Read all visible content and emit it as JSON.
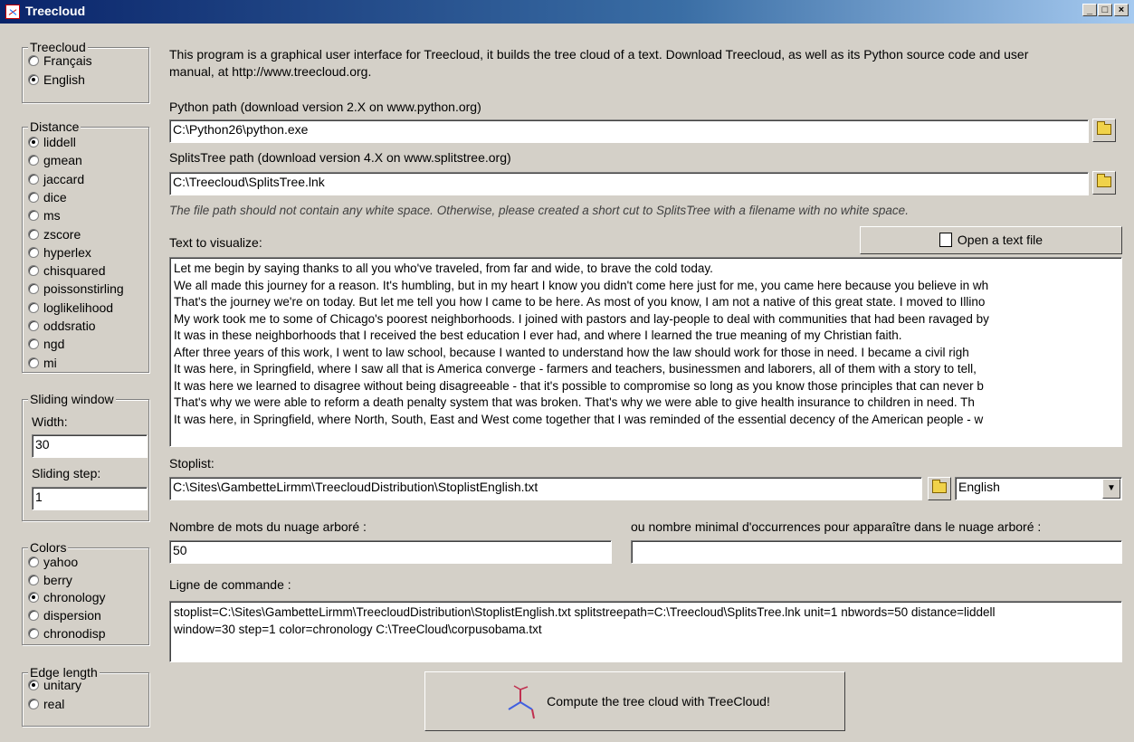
{
  "window": {
    "title": "Treecloud",
    "minimize": "_",
    "maximize": "□",
    "close": "×"
  },
  "left": {
    "language": {
      "legend": "Treecloud",
      "options": [
        "Français",
        "English"
      ],
      "selected": "English"
    },
    "distance": {
      "legend": "Distance",
      "options": [
        "liddell",
        "gmean",
        "jaccard",
        "dice",
        "ms",
        "zscore",
        "hyperlex",
        "chisquared",
        "poissonstirling",
        "loglikelihood",
        "oddsratio",
        "ngd",
        "mi"
      ],
      "selected": "liddell"
    },
    "sliding": {
      "legend": "Sliding window",
      "width_label": "Width:",
      "width_value": "30",
      "step_label": "Sliding step:",
      "step_value": "1"
    },
    "colors": {
      "legend": "Colors",
      "options": [
        "yahoo",
        "berry",
        "chronology",
        "dispersion",
        "chronodisp"
      ],
      "selected": "chronology"
    },
    "edge": {
      "legend": "Edge length",
      "options": [
        "unitary",
        "real"
      ],
      "selected": "unitary"
    }
  },
  "main": {
    "intro_line1": "This program is a graphical user interface for Treecloud, it builds the tree cloud of a text. Download Treecloud, as well as its Python source code and user",
    "intro_line2": "manual, at http://www.treecloud.org.",
    "python_label": "Python path (download version 2.X on www.python.org)",
    "python_value": "C:\\Python26\\python.exe",
    "splits_label": "SplitsTree path (download version 4.X on www.splitstree.org)",
    "splits_value": "C:\\Treecloud\\SplitsTree.lnk",
    "warning": "The file path should not contain any white space. Otherwise, please created a short cut to SplitsTree with a filename with no white space.",
    "text_label": "Text to visualize:",
    "open_button": "Open a text file",
    "text_lines": [
      "Let me begin by saying thanks to all you who've traveled, from far and wide, to brave the cold today.",
      "We all made this journey for a reason. It's humbling, but in my heart I know you didn't come here just for me, you came here because you believe in wh",
      "That's the journey we're on today. But let me tell you how I came to be here. As most of you know, I am not a native of this great state. I moved to Illino",
      "My work took me to some of Chicago's poorest neighborhoods. I joined with pastors and lay-people to deal with communities that had been ravaged by",
      "It was in these neighborhoods that I received the best education I ever had, and where I learned the true meaning of my Christian faith.",
      "After three years of this work, I went to law school, because I wanted to understand how the law should work for those in need. I became a civil righ",
      "It was here, in Springfield, where I saw all that is America converge - farmers and teachers, businessmen and laborers, all of them with a story to tell,",
      "It was here we learned to disagree without being disagreeable - that it's possible to compromise so long as you know those principles that can never b",
      "That's why we were able to reform a death penalty system that was broken. That's why we were able to give health insurance to children in need. Th",
      "It was here, in Springfield, where North, South, East and West come together that I was reminded of the essential decency of the American people - w"
    ],
    "stoplist_label": "Stoplist:",
    "stoplist_value": "C:\\Sites\\GambetteLirmm\\TreecloudDistribution\\StoplistEnglish.txt",
    "stoplist_lang": "English",
    "nbwords_label": "Nombre de mots du nuage arboré :",
    "nbwords_value": "50",
    "minocc_label": "ou nombre minimal d'occurrences pour apparaître dans le nuage arboré :",
    "minocc_value": "",
    "cmd_label": "Ligne de commande :",
    "cmd_line1": "stoplist=C:\\Sites\\GambetteLirmm\\TreecloudDistribution\\StoplistEnglish.txt splitstreepath=C:\\Treecloud\\SplitsTree.lnk unit=1 nbwords=50 distance=liddell",
    "cmd_line2": "window=30 step=1 color=chronology C:\\TreeCloud\\corpusobama.txt",
    "compute_button": "Compute the tree cloud with TreeCloud!"
  }
}
